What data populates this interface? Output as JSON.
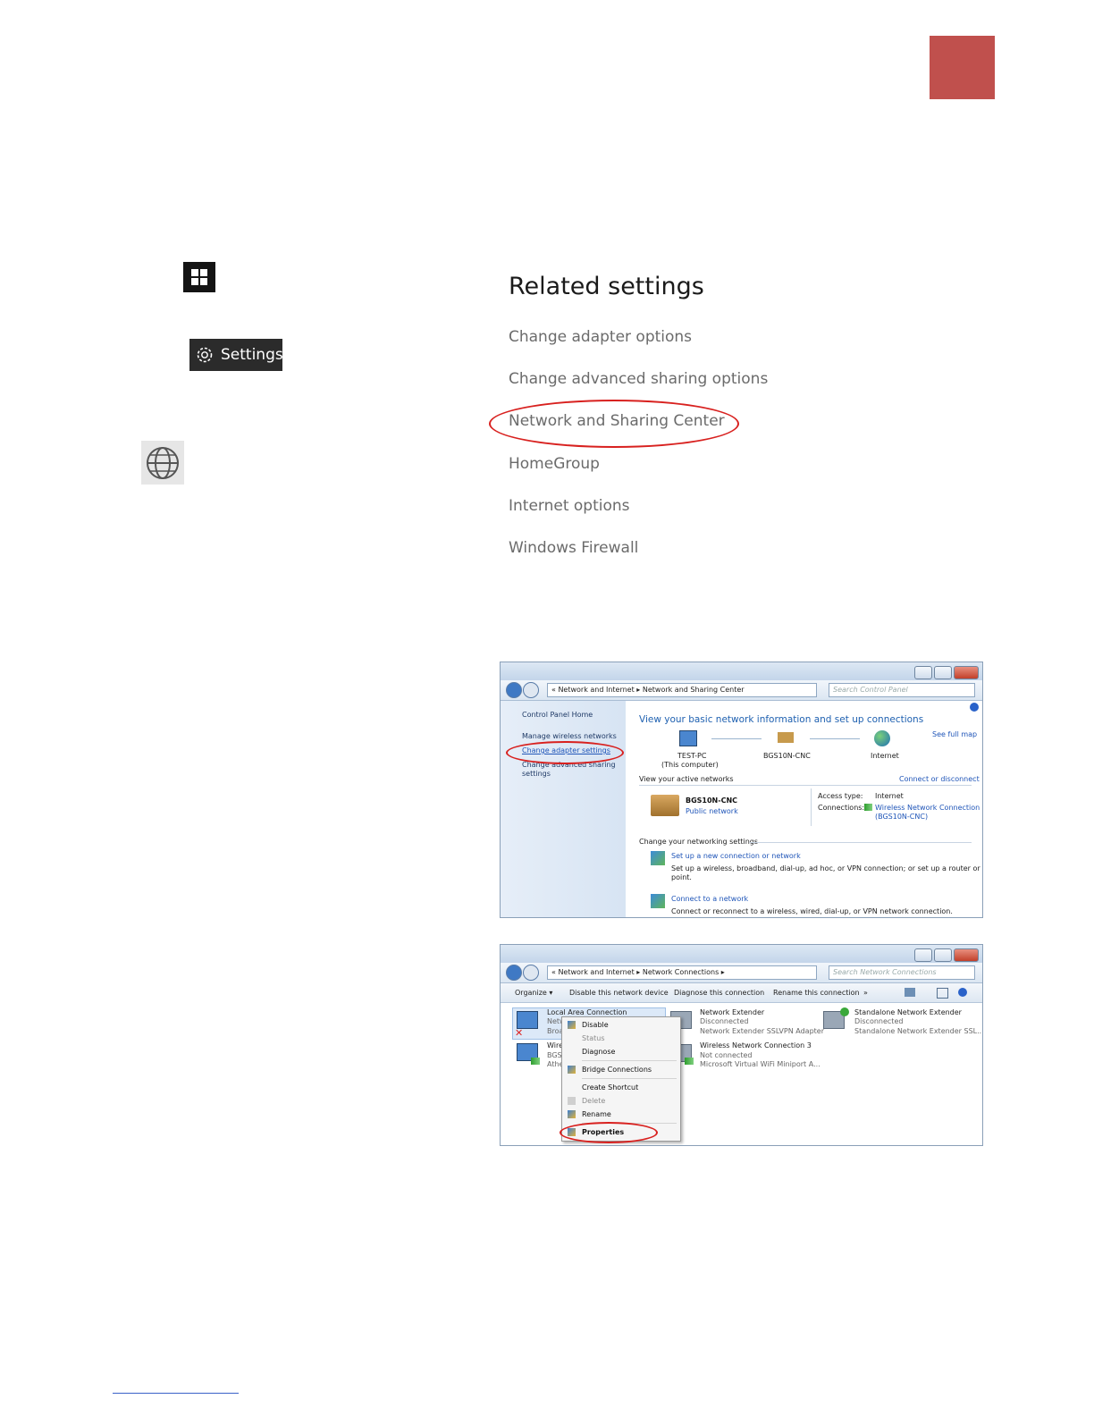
{
  "start_icon": "windows-logo-icon",
  "settings_button": {
    "label": "Settings",
    "icon": "gear-icon"
  },
  "network_icon": "globe-icon",
  "related": {
    "title": "Related settings",
    "links": [
      "Change adapter options",
      "Change advanced sharing options",
      "Network and Sharing Center",
      "HomeGroup",
      "Internet options",
      "Windows Firewall"
    ],
    "highlight_color": "#d8211f"
  },
  "accent_tab_color": "#c0504d",
  "nsc": {
    "breadcrumb": [
      "Network and Internet",
      "Network and Sharing Center"
    ],
    "search_placeholder": "Search Control Panel",
    "left_items": [
      "Control Panel Home",
      "Manage wireless networks",
      "Change adapter settings",
      "Change advanced sharing",
      "settings"
    ],
    "header": "View your basic network information and set up connections",
    "see_full_map": "See full map",
    "nodes": [
      "TEST-PC",
      "(This computer)",
      "BGS10N-CNC",
      "Internet"
    ],
    "active_label": "View your active networks",
    "connect_disconnect": "Connect or disconnect",
    "network_name": "BGS10N-CNC",
    "network_type": "Public network",
    "access_type_label": "Access type:",
    "access_type_value": "Internet",
    "connections_label": "Connections:",
    "connection_value": "Wireless Network Connection",
    "connection_value2": "(BGS10N-CNC)",
    "change_label": "Change your networking settings",
    "tasks": [
      {
        "title": "Set up a new connection or network",
        "desc": "Set up a wireless, broadband, dial-up, ad hoc, or VPN connection; or set up a router or access",
        "desc2": "point."
      },
      {
        "title": "Connect to a network",
        "desc": "Connect or reconnect to a wireless, wired, dial-up, or VPN network connection."
      }
    ]
  },
  "nc": {
    "breadcrumb": [
      "Network and Internet",
      "Network Connections"
    ],
    "search_placeholder": "Search Network Connections",
    "toolbar": [
      "Organize ▾",
      "Disable this network device",
      "Diagnose this connection",
      "Rename this connection",
      "»"
    ],
    "adapters": [
      {
        "name": "Local Area Connection",
        "l2": "Netw",
        "l3": "Broa"
      },
      {
        "name": "Wire",
        "l2": "BGS1",
        "l3": "Athe"
      },
      {
        "name": "Network Extender",
        "l2": "Disconnected",
        "l3": "Network Extender SSLVPN Adapter"
      },
      {
        "name": "Wireless Network Connection 3",
        "l2": "Not connected",
        "l3": "Microsoft Virtual WiFi Miniport A..."
      },
      {
        "name": "Standalone Network Extender",
        "l2": "Disconnected",
        "l3": "Standalone Network Extender SSL..."
      }
    ],
    "menu": [
      "Disable",
      "Status",
      "Diagnose",
      "Bridge Connections",
      "Create Shortcut",
      "Delete",
      "Rename",
      "Properties"
    ]
  }
}
